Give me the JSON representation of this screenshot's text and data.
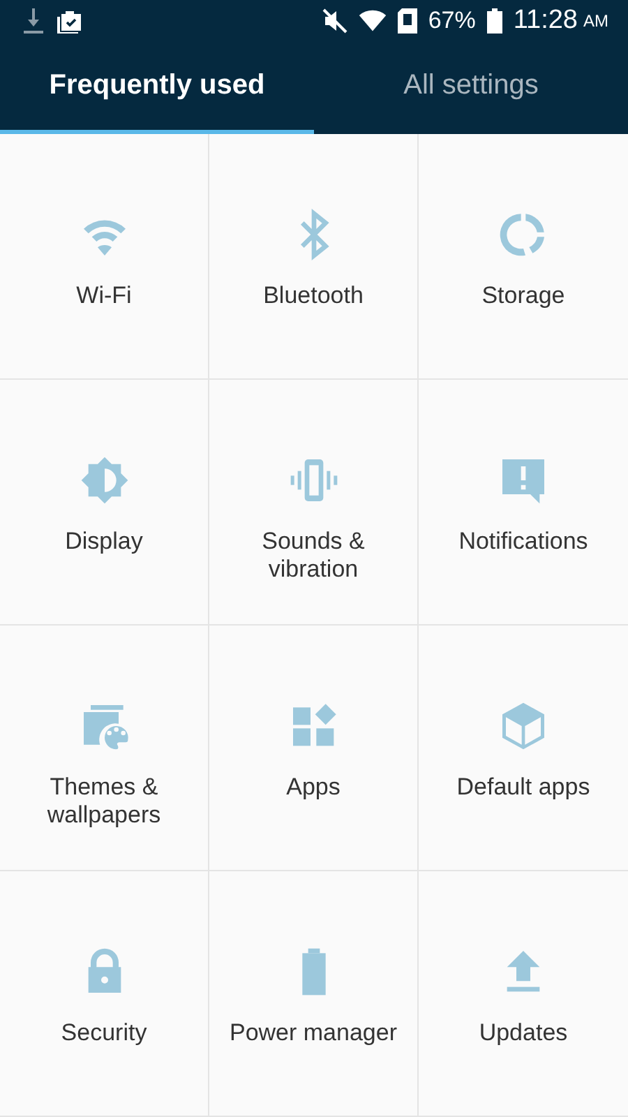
{
  "status_bar": {
    "battery_text": "67%",
    "time": "11:28",
    "meridiem": "AM"
  },
  "tabs": [
    {
      "label": "Frequently used",
      "selected": true
    },
    {
      "label": "All settings",
      "selected": false
    }
  ],
  "tiles": [
    {
      "label": "Wi-Fi",
      "kind": "wifi"
    },
    {
      "label": "Bluetooth",
      "kind": "bluetooth"
    },
    {
      "label": "Storage",
      "kind": "storage"
    },
    {
      "label": "Display",
      "kind": "display"
    },
    {
      "label": "Sounds & vibration",
      "kind": "vibration"
    },
    {
      "label": "Notifications",
      "kind": "notifications"
    },
    {
      "label": "Themes & wallpapers",
      "kind": "themes"
    },
    {
      "label": "Apps",
      "kind": "apps"
    },
    {
      "label": "Default apps",
      "kind": "defaultapps"
    },
    {
      "label": "Security",
      "kind": "security"
    },
    {
      "label": "Power manager",
      "kind": "power"
    },
    {
      "label": "Updates",
      "kind": "updates"
    }
  ]
}
